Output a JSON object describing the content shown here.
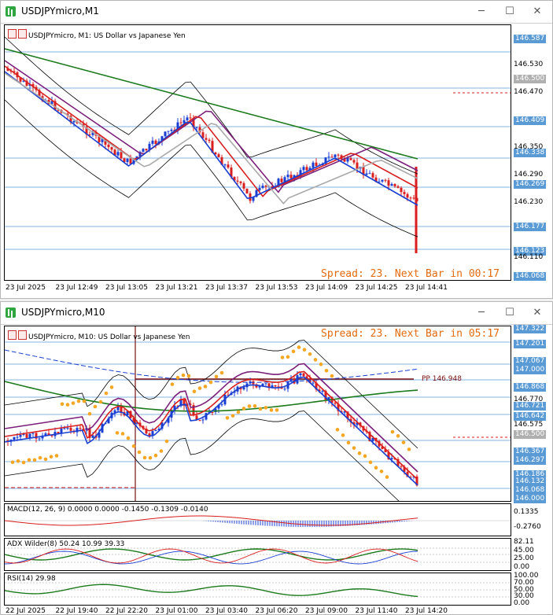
{
  "window1": {
    "title": "USDJPYmicro,M1",
    "chart_label": "USDJPYmicro, M1:  US Dollar vs Japanese Yen",
    "spread_text": "Spread: 23. Next Bar in 00:17",
    "price_axis": [
      "146.587",
      "146.530",
      "146.500",
      "146.470",
      "146.409",
      "146.350",
      "146.338",
      "146.290",
      "146.269",
      "146.230",
      "146.177",
      "146.123",
      "146.110",
      "146.068"
    ],
    "time_axis": [
      "23 Jul 2025",
      "23 Jul 12:49",
      "23 Jul 13:05",
      "23 Jul 13:21",
      "23 Jul 13:37",
      "23 Jul 13:53",
      "23 Jul 14:09",
      "23 Jul 14:25",
      "23 Jul 14:41"
    ]
  },
  "window2": {
    "title": "USDJPYmicro,M10",
    "chart_label": "USDJPYmicro, M10:  US Dollar vs Japanese Yen",
    "spread_text": "Spread: 23. Next Bar in 05:17",
    "pp_label": "PP 146.948",
    "price_axis": [
      "147.322",
      "147.201",
      "147.067",
      "147.000",
      "146.868",
      "146.770",
      "146.721",
      "146.642",
      "146.575",
      "146.500",
      "146.367",
      "146.297",
      "146.186",
      "146.132",
      "146.068",
      "146.000"
    ],
    "macd": {
      "label": "MACD(12, 26, 9) 0.0000 0.0000 -0.1450 -0.1309 -0.0140",
      "axis": [
        "0.1335",
        "-0.2760"
      ]
    },
    "adx": {
      "label": "ADX Wilder(8) 50.24 10.99 39.33",
      "axis": [
        "82.11",
        "45.00",
        "25.00",
        "0.00"
      ]
    },
    "rsi": {
      "label": "RSI(14) 29.98",
      "axis": [
        "100.00",
        "70.00",
        "50.00",
        "30.00",
        "0.00"
      ]
    },
    "time_axis": [
      "22 Jul 2025",
      "22 Jul 19:40",
      "22 Jul 22:20",
      "23 Jul 01:00",
      "23 Jul 03:40",
      "23 Jul 06:20",
      "23 Jul 09:00",
      "23 Jul 11:40",
      "23 Jul 14:20"
    ]
  },
  "colors": {
    "accent": "#5b9bd5",
    "bull": "#1a3fd0",
    "bear": "#d81e1e",
    "spread": "#e26b10"
  }
}
